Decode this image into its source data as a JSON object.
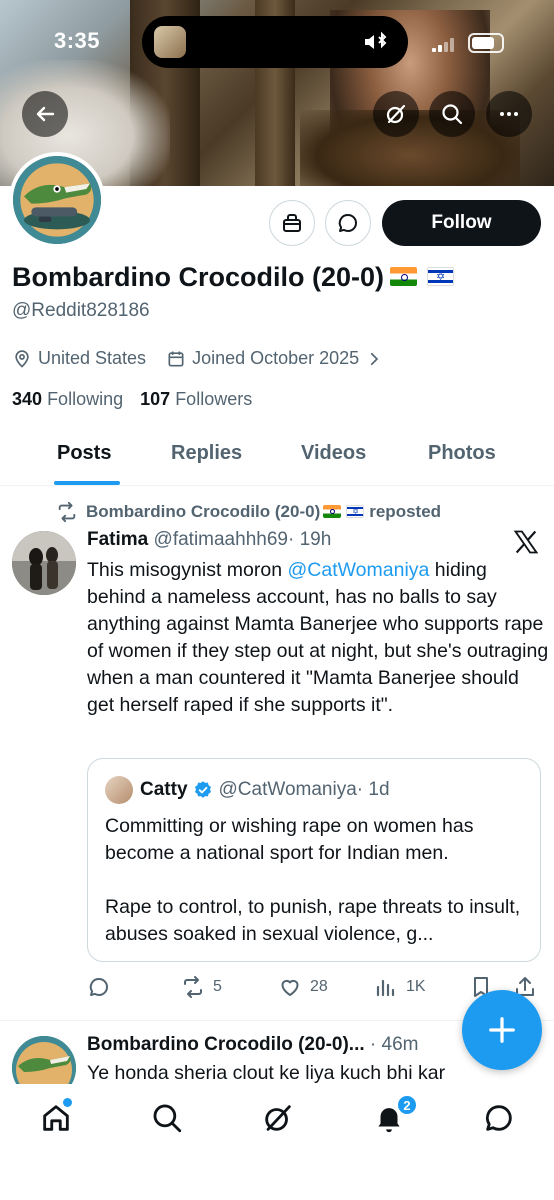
{
  "status_bar": {
    "time": "3:35"
  },
  "profile": {
    "name": "Bombardino Crocodilo (20-0)",
    "handle": "@Reddit828186",
    "location": "United States",
    "joined": "Joined October 2025",
    "following_count": "340",
    "following_label": "Following",
    "followers_count": "107",
    "followers_label": "Followers",
    "follow_button": "Follow"
  },
  "tabs": [
    {
      "label": "Posts",
      "active": true
    },
    {
      "label": "Replies",
      "active": false
    },
    {
      "label": "Videos",
      "active": false
    },
    {
      "label": "Photos",
      "active": false
    }
  ],
  "post": {
    "repost_by": "Bombardino Crocodilo (20-0)",
    "repost_suffix": "reposted",
    "author_name": "Fatima",
    "author_handle": "@fatimaahhh69",
    "time": "· 19h",
    "text_before_mention": "This misogynist moron ",
    "mention": "@CatWomaniya",
    "text_after_mention": " hiding behind a nameless account, has no balls to say anything against Mamta Banerjee who supports rape of women if they step out at night, but she's outraging when a man countered it \"Mamta Banerjee should get herself raped if she supports it\".",
    "quote": {
      "name": "Catty",
      "handle": "@CatWomaniya",
      "time": "· 1d",
      "text": "Committing or wishing rape on women has become a national sport for Indian men.\n\nRape to control, to punish, rape threats to insult, abuses soaked in sexual violence, g..."
    },
    "reposts": "5",
    "likes": "28",
    "views": "1K"
  },
  "post2": {
    "author_name": "Bombardino Crocodilo (20-0)...",
    "time": "· 46m",
    "text": "Ye honda sheria clout ke liya kuch bhi kar"
  },
  "notifications_badge": "2",
  "colors": {
    "accent": "#1d9bf0",
    "text": "#0f1419",
    "muted": "#536471"
  }
}
